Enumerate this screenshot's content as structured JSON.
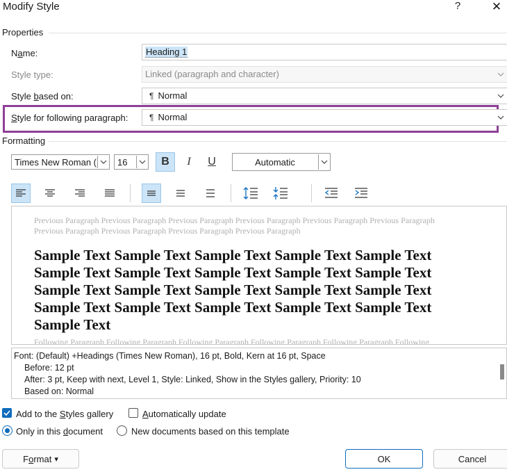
{
  "dialog": {
    "title": "Modify Style",
    "help_glyph": "?",
    "close_glyph": "✕"
  },
  "properties": {
    "group_label": "Properties",
    "name_label_pre": "N",
    "name_label_ul": "a",
    "name_label_post": "me:",
    "name_value": "Heading 1",
    "style_type_label": "Style type:",
    "style_type_value": "Linked (paragraph and character)",
    "based_on_label_pre": "Style ",
    "based_on_label_ul": "b",
    "based_on_label_post": "ased on:",
    "based_on_value": "Normal",
    "following_label_ul": "S",
    "following_label_post": "tyle for following paragraph:",
    "following_value": "Normal",
    "pilcrow": "¶"
  },
  "formatting": {
    "group_label": "Formatting",
    "font_name": "Times New Roman (",
    "font_size": "16",
    "bold_glyph": "B",
    "italic_glyph": "I",
    "underline_glyph": "U",
    "font_color": "Automatic"
  },
  "preview": {
    "previous_paragraph": "Previous Paragraph Previous Paragraph Previous Paragraph Previous Paragraph Previous Paragraph Previous Paragraph Previous Paragraph Previous Paragraph Previous Paragraph Previous Paragraph",
    "sample_lines": [
      "Sample Text Sample Text Sample Text Sample Text Sample Text",
      "Sample Text Sample Text Sample Text Sample Text Sample Text",
      "Sample Text Sample Text Sample Text Sample Text Sample Text",
      "Sample Text Sample Text Sample Text Sample Text Sample Text",
      "Sample Text"
    ],
    "following_paragraph": "Following Paragraph Following Paragraph Following Paragraph Following Paragraph Following Paragraph Following"
  },
  "description": {
    "line1": "Font: (Default) +Headings (Times New Roman), 16 pt, Bold, Kern at 16 pt, Space",
    "line2": "Before:  12 pt",
    "line3": "After:  3 pt, Keep with next, Level 1, Style: Linked, Show in the Styles gallery, Priority: 10",
    "line4": "Based on: Normal"
  },
  "options": {
    "add_to_gallery_pre": "Add to the ",
    "add_to_gallery_ul": "S",
    "add_to_gallery_post": "tyles gallery",
    "add_to_gallery_checked": true,
    "auto_update_ul": "A",
    "auto_update_post": "utomatically update",
    "auto_update_checked": false,
    "only_this_doc_pre": "Only in this ",
    "only_this_doc_ul": "d",
    "only_this_doc_post": "ocument",
    "new_docs": "New documents based on this template"
  },
  "buttons": {
    "format_pre": "F",
    "format_ul": "o",
    "format_post": "rmat",
    "format_arrow": "▾",
    "ok": "OK",
    "cancel": "Cancel"
  },
  "colors": {
    "highlight_border": "#8e3f96",
    "accent": "#0f6cbd",
    "selection": "#cce4f7"
  }
}
